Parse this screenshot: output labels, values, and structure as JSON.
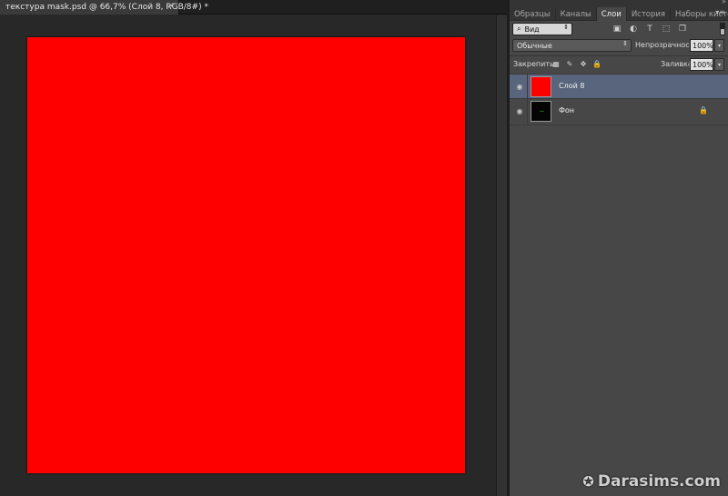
{
  "document": {
    "tab_title": "текстура mask.psd @ 66,7% (Слой 8, RGB/8#) *",
    "close_glyph": "×",
    "canvas_color": "#ff0000"
  },
  "panel": {
    "collapse_glyph": "»",
    "menu_glyph": "▾≡",
    "tabs": [
      {
        "label": "Образцы"
      },
      {
        "label": "Каналы"
      },
      {
        "label": "Слои"
      },
      {
        "label": "История"
      },
      {
        "label": "Наборы кистей"
      }
    ],
    "active_tab": "Слои",
    "filter": {
      "search_glyph": "⌕",
      "label": "Вид",
      "arrow": "⇕",
      "icons": [
        {
          "name": "pixel-filter-icon",
          "glyph": "▣"
        },
        {
          "name": "adjustment-filter-icon",
          "glyph": "◐"
        },
        {
          "name": "type-filter-icon",
          "glyph": "T"
        },
        {
          "name": "shape-filter-icon",
          "glyph": "⬚"
        },
        {
          "name": "smart-object-filter-icon",
          "glyph": "❐"
        }
      ]
    },
    "blend_mode": {
      "label": "Обычные",
      "arrow": "⇕"
    },
    "opacity": {
      "label": "Непрозрачность:",
      "value": "100%",
      "arrow": "▾"
    },
    "lock": {
      "label": "Закрепить:",
      "icons": [
        {
          "name": "lock-transparent-icon",
          "glyph": "▦"
        },
        {
          "name": "lock-image-icon",
          "glyph": "✎"
        },
        {
          "name": "lock-position-icon",
          "glyph": "✥"
        },
        {
          "name": "lock-all-icon",
          "glyph": "🔒"
        }
      ]
    },
    "fill": {
      "label": "Заливка:",
      "value": "100%",
      "arrow": "▾"
    },
    "layers": [
      {
        "name": "Слой 8",
        "eye": "◉",
        "thumb_color": "#ff0000",
        "selected": true,
        "locked": false
      },
      {
        "name": "Фон",
        "eye": "◉",
        "thumb_color": "#050505",
        "selected": false,
        "locked": true,
        "lock_glyph": "🔒"
      }
    ]
  },
  "watermark": {
    "star": "✪",
    "text": "Darasims.com"
  }
}
